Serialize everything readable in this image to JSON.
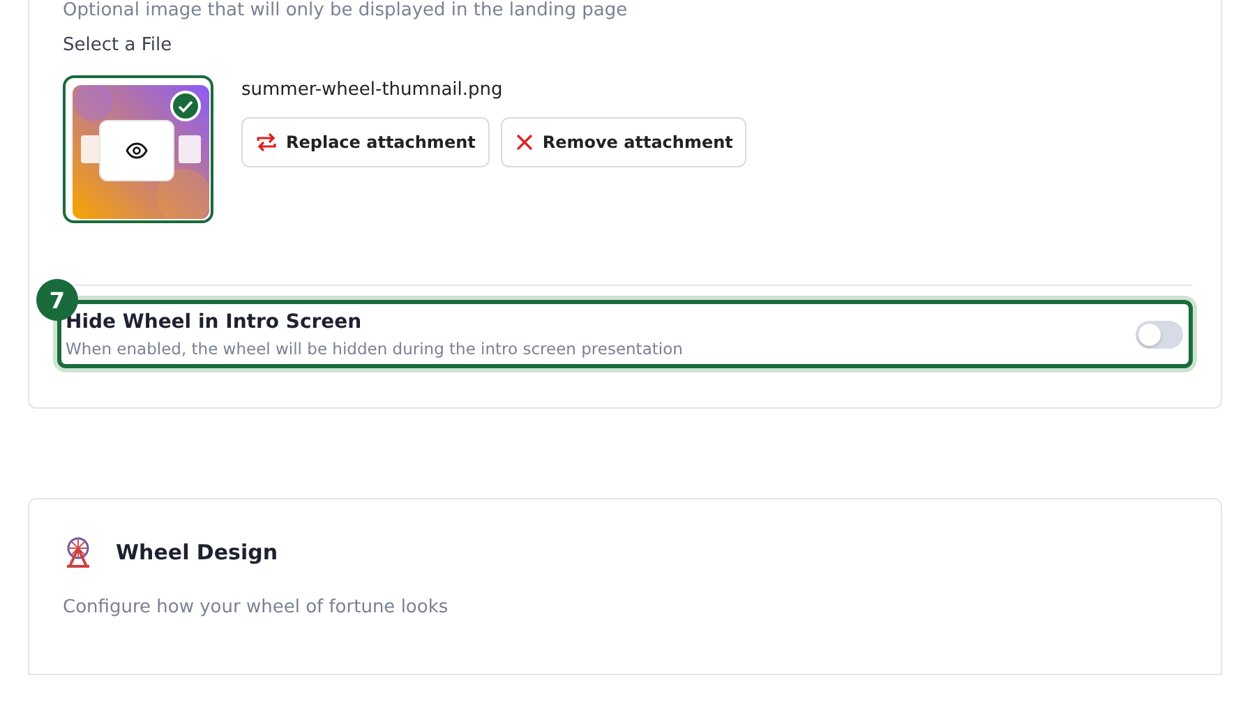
{
  "image_section": {
    "hint": "Optional image that will only be displayed in the landing page",
    "file_label": "Select a File",
    "file": {
      "name": "summer-wheel-thumnail.png",
      "selected": true
    },
    "buttons": [
      {
        "kind": "replace",
        "label": "Replace attachment"
      },
      {
        "kind": "remove",
        "label": "Remove attachment"
      }
    ]
  },
  "step_badge": "7",
  "hide_wheel": {
    "title": "Hide Wheel in Intro Screen",
    "description": "When enabled, the wheel will be hidden during the intro screen presentation",
    "on": false,
    "highlighted": true
  },
  "wheel_design": {
    "title": "Wheel Design",
    "description": "Configure how your wheel of fortune looks"
  }
}
